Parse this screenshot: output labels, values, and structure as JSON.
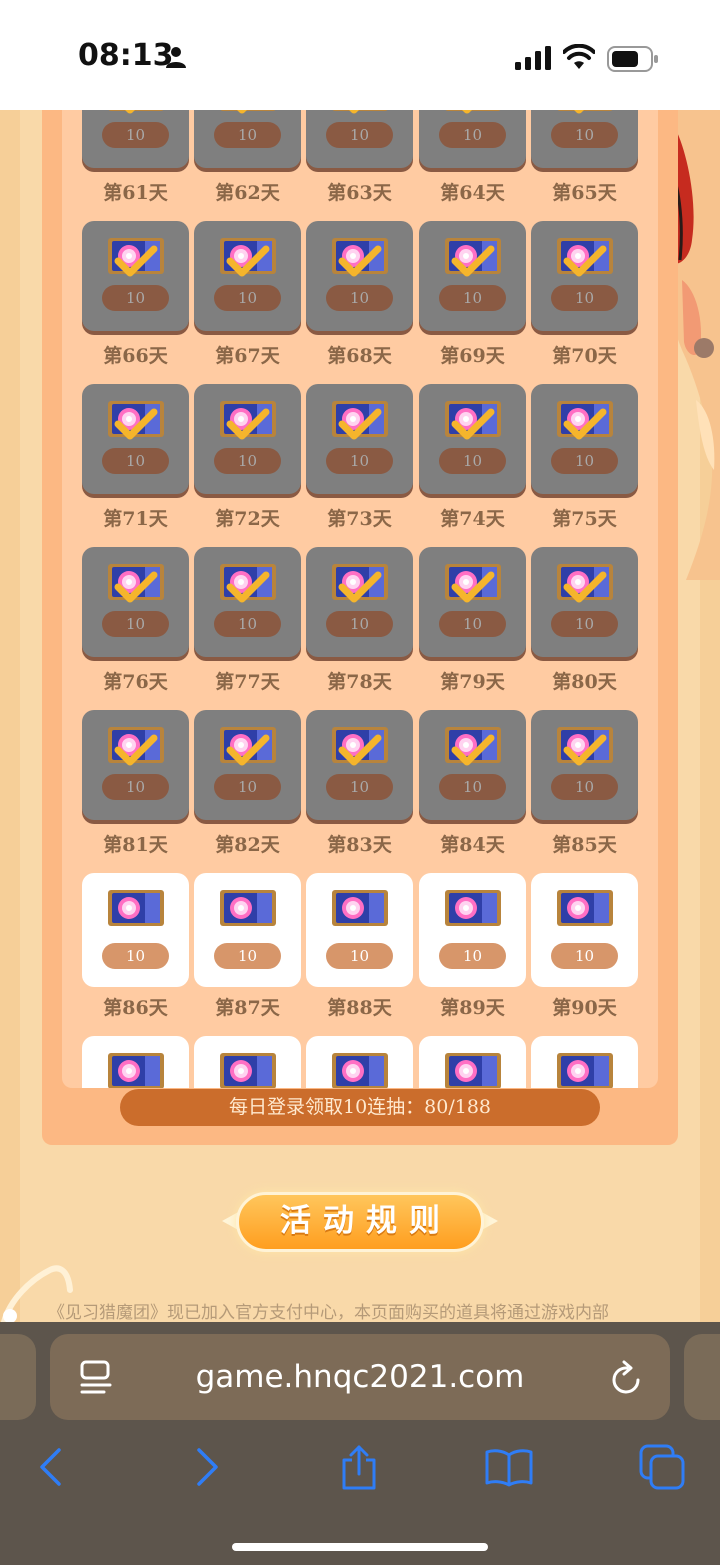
{
  "status_bar": {
    "time": "08:13"
  },
  "grid": {
    "rows": [
      {
        "tiles": [
          {
            "count": "10",
            "claimed": true
          },
          {
            "count": "10",
            "claimed": true
          },
          {
            "count": "10",
            "claimed": true
          },
          {
            "count": "10",
            "claimed": true
          },
          {
            "count": "10",
            "claimed": true
          }
        ],
        "days": [
          "第61天",
          "第62天",
          "第63天",
          "第64天",
          "第65天"
        ]
      },
      {
        "tiles": [
          {
            "count": "10",
            "claimed": true
          },
          {
            "count": "10",
            "claimed": true
          },
          {
            "count": "10",
            "claimed": true
          },
          {
            "count": "10",
            "claimed": true
          },
          {
            "count": "10",
            "claimed": true
          }
        ],
        "days": [
          "第66天",
          "第67天",
          "第68天",
          "第69天",
          "第70天"
        ]
      },
      {
        "tiles": [
          {
            "count": "10",
            "claimed": true
          },
          {
            "count": "10",
            "claimed": true
          },
          {
            "count": "10",
            "claimed": true
          },
          {
            "count": "10",
            "claimed": true
          },
          {
            "count": "10",
            "claimed": true
          }
        ],
        "days": [
          "第71天",
          "第72天",
          "第73天",
          "第74天",
          "第75天"
        ]
      },
      {
        "tiles": [
          {
            "count": "10",
            "claimed": true
          },
          {
            "count": "10",
            "claimed": true
          },
          {
            "count": "10",
            "claimed": true
          },
          {
            "count": "10",
            "claimed": true
          },
          {
            "count": "10",
            "claimed": true
          }
        ],
        "days": [
          "第76天",
          "第77天",
          "第78天",
          "第79天",
          "第80天"
        ]
      },
      {
        "tiles": [
          {
            "count": "10",
            "claimed": true
          },
          {
            "count": "10",
            "claimed": true
          },
          {
            "count": "10",
            "claimed": true
          },
          {
            "count": "10",
            "claimed": true
          },
          {
            "count": "10",
            "claimed": true
          }
        ],
        "days": [
          "第81天",
          "第82天",
          "第83天",
          "第84天",
          "第85天"
        ]
      },
      {
        "tiles": [
          {
            "count": "10",
            "claimed": false
          },
          {
            "count": "10",
            "claimed": false
          },
          {
            "count": "10",
            "claimed": false
          },
          {
            "count": "10",
            "claimed": false
          },
          {
            "count": "10",
            "claimed": false
          }
        ],
        "days": [
          "第86天",
          "第87天",
          "第88天",
          "第89天",
          "第90天"
        ]
      },
      {
        "tiles": [
          {
            "count": "",
            "claimed": false
          },
          {
            "count": "",
            "claimed": false
          },
          {
            "count": "",
            "claimed": false
          },
          {
            "count": "",
            "claimed": false
          },
          {
            "count": "",
            "claimed": false
          }
        ],
        "days": [
          "",
          "",
          "",
          "",
          ""
        ]
      }
    ]
  },
  "progress": {
    "label": "每日登录领取10连抽：80/188",
    "current": 80,
    "total": 188
  },
  "rules": {
    "button_label": "活动规则",
    "text": "《见习猎魔团》现已加入官方支付中心，本页面购买的道具将通过游戏内部"
  },
  "browser": {
    "url": "game.hnqc2021.com"
  },
  "colors": {
    "claimed_tile": "#7f7f7f",
    "card": "#fcb883",
    "progress": "#cb6d2c",
    "rules_button": "#ff9e1f"
  }
}
